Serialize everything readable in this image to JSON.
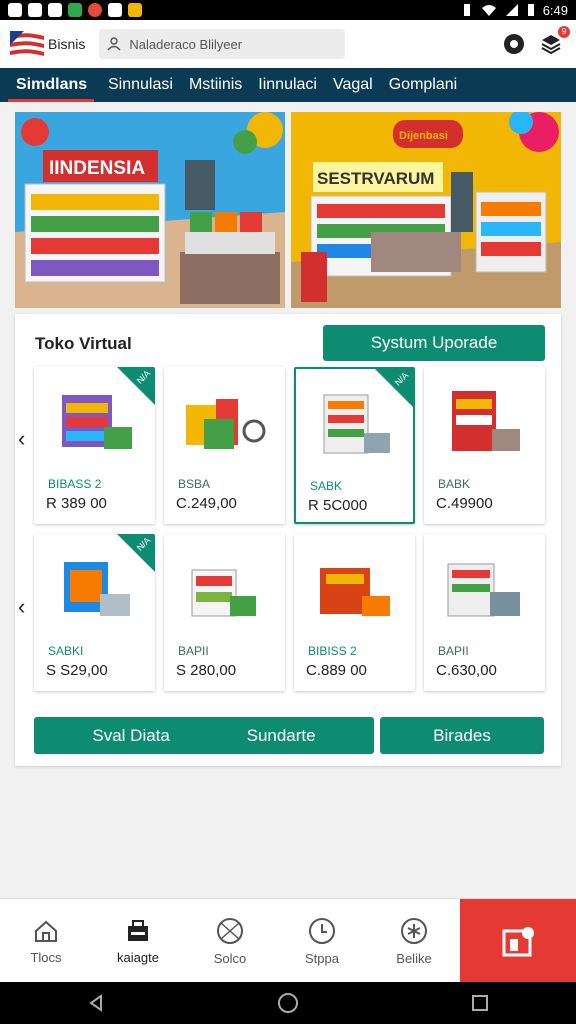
{
  "status_bar": {
    "time": "6:49"
  },
  "app_bar": {
    "brand": "Bisnis",
    "search_placeholder": "Naladeraco Blilyeer",
    "notification_count": "9"
  },
  "tabs": [
    {
      "label": "Simdlans",
      "active": true
    },
    {
      "label": "Sinnulasi",
      "active": false
    },
    {
      "label": "Mstiinis",
      "active": false
    },
    {
      "label": "Iinnulaci",
      "active": false
    },
    {
      "label": "Vagal",
      "active": false
    },
    {
      "label": "Gomplani",
      "active": false
    }
  ],
  "banners": [
    {
      "sign_text": "IINDENSIA"
    },
    {
      "sign_text": "SESTRVARUM",
      "badge_text": "Dijenbasi"
    }
  ],
  "section": {
    "title": "Toko Virtual",
    "upgrade_button": "Systum Uporade",
    "products": [
      {
        "code": "BIBASS 2",
        "price": "R 389 00",
        "tag": "N/A",
        "selected": false
      },
      {
        "code": "BSBA",
        "price": "C.249,00",
        "tag": "",
        "selected": false
      },
      {
        "code": "SABK",
        "price": "R 5C000",
        "tag": "N/A",
        "selected": true
      },
      {
        "code": "BABK",
        "price": "C.49900",
        "tag": "",
        "selected": false
      },
      {
        "code": "SABKI",
        "price": "S S29,00",
        "tag": "N/A",
        "selected": false
      },
      {
        "code": "BAPII",
        "price": "S 280,00",
        "tag": "",
        "selected": false
      },
      {
        "code": "BIBISS 2",
        "price": "C.889 00",
        "tag": "",
        "selected": false
      },
      {
        "code": "BAPII",
        "price": "C.630,00",
        "tag": "",
        "selected": false
      }
    ],
    "bottom_buttons": {
      "left_a": "Sval Diata",
      "left_b": "Sundarte",
      "right": "Birades"
    }
  },
  "bottom_nav": [
    {
      "label": "Tlocs",
      "icon": "home-icon"
    },
    {
      "label": "kaiagte",
      "icon": "register-icon"
    },
    {
      "label": "Solco",
      "icon": "globe-icon"
    },
    {
      "label": "Stppa",
      "icon": "clock-icon"
    },
    {
      "label": "Belike",
      "icon": "star-icon"
    }
  ],
  "colors": {
    "accent": "#0d8c72",
    "tabbar": "#0b3a55",
    "red": "#e53935"
  }
}
